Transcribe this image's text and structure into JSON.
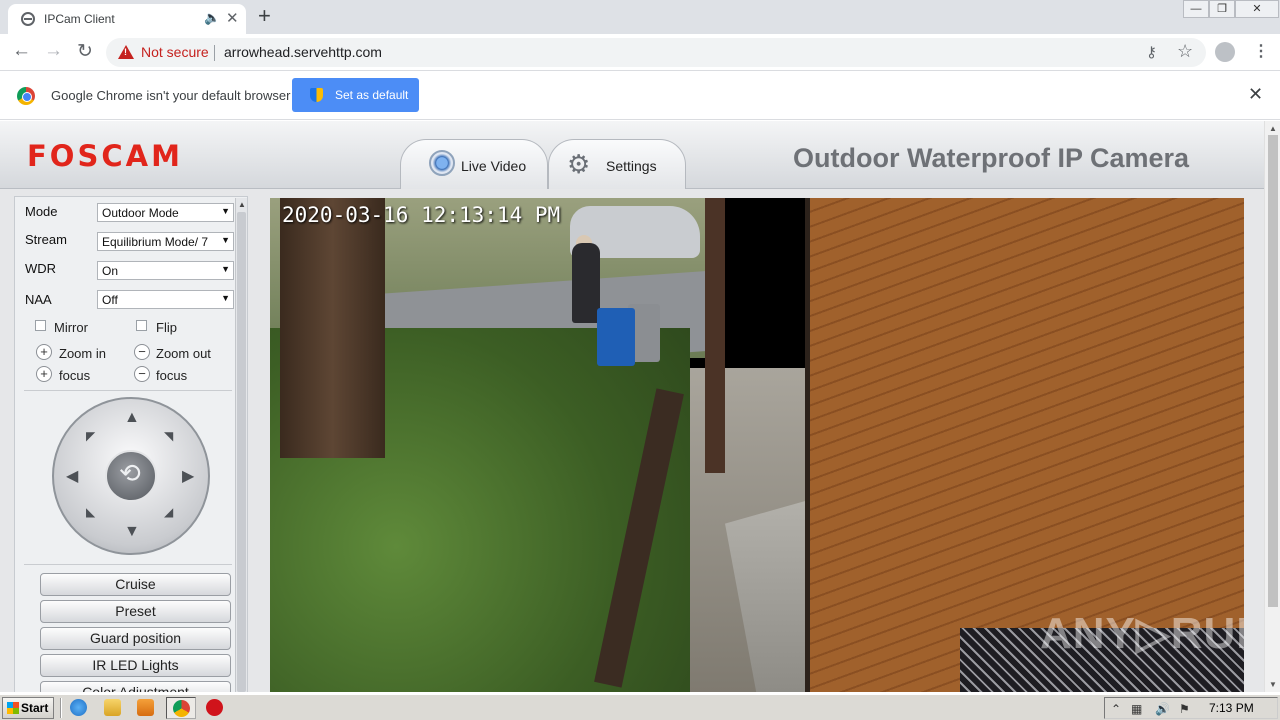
{
  "browser": {
    "tab_title": "IPCam Client",
    "not_secure": "Not secure",
    "url": "arrowhead.servehttp.com",
    "window_controls": [
      "—",
      "❐",
      "✕"
    ],
    "icons": {
      "back": "←",
      "forward": "→",
      "reload": "↻",
      "audio": "🔈",
      "tab_close": "✕",
      "new_tab": "+",
      "key": "⚷",
      "star": "☆",
      "menu": "⋮",
      "infobar_close": "✕"
    }
  },
  "infobar": {
    "message": "Google Chrome isn't your default browser",
    "button": "Set as default"
  },
  "page": {
    "logo": "FOSCAM",
    "title": "Outdoor Waterproof IP Camera",
    "tabs": [
      {
        "label": "Live Video",
        "icon": "camera-icon"
      },
      {
        "label": "Settings",
        "icon": "gear-icon"
      }
    ],
    "tab_glyphs": {
      "settings": "⚙"
    }
  },
  "controls": {
    "mode": {
      "label": "Mode",
      "value": "Outdoor Mode"
    },
    "stream": {
      "label": "Stream",
      "value": "Equilibrium Mode/ 7"
    },
    "wdr": {
      "label": "WDR",
      "value": "On"
    },
    "naa": {
      "label": "NAA",
      "value": "Off"
    },
    "dropdown_arrow": "▼",
    "mirror": "Mirror",
    "flip": "Flip",
    "zoom_in": "Zoom in",
    "zoom_out": "Zoom out",
    "focus_in": "focus",
    "focus_out": "focus",
    "plus": "+",
    "minus": "−",
    "ptz": {
      "home": "⟲",
      "up": "▲",
      "down": "▼",
      "left": "◀",
      "right": "▶",
      "up_left": "◤",
      "up_right": "◥",
      "down_left": "◣",
      "down_right": "◢"
    },
    "buttons": [
      "Cruise",
      "Preset",
      "Guard position",
      "IR LED Lights",
      "Color Adjustment"
    ]
  },
  "video": {
    "timestamp": "2020-03-16 12:13:14 PM",
    "watermark": "ANY▷RUN"
  },
  "scroll_arrows": {
    "up": "▲",
    "down": "▼"
  },
  "taskbar": {
    "start": "Start",
    "clock": "7:13 PM",
    "tray_glyphs": [
      "⌃",
      "▦",
      "🔊",
      "⚑"
    ]
  },
  "colors": {
    "brand": "#e1251b",
    "accent": "#4c8df6",
    "warning": "#c5221f"
  }
}
